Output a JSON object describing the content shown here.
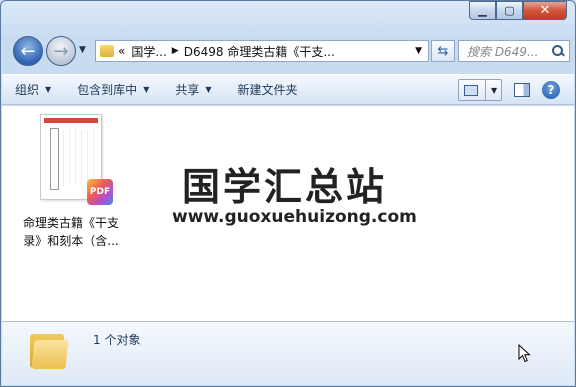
{
  "address": {
    "overflow": "«",
    "crumbs": [
      "国学...",
      "D6498 命理类古籍《干支..."
    ]
  },
  "search": {
    "placeholder": "搜索 D649..."
  },
  "toolbar": {
    "organize": "组织",
    "include_in_library": "包含到库中",
    "share": "共享",
    "new_folder": "新建文件夹"
  },
  "file": {
    "badge": "PDF",
    "name": "命理类古籍《干支录》和刻本（含..."
  },
  "watermark": {
    "title": "国学汇总站",
    "url": "www.guoxuehuizong.com"
  },
  "details": {
    "count": "1 个对象"
  },
  "icons": {
    "back": "back-arrow-icon",
    "forward": "forward-arrow-icon",
    "refresh": "refresh-icon",
    "search": "search-icon",
    "help": "help-icon"
  }
}
